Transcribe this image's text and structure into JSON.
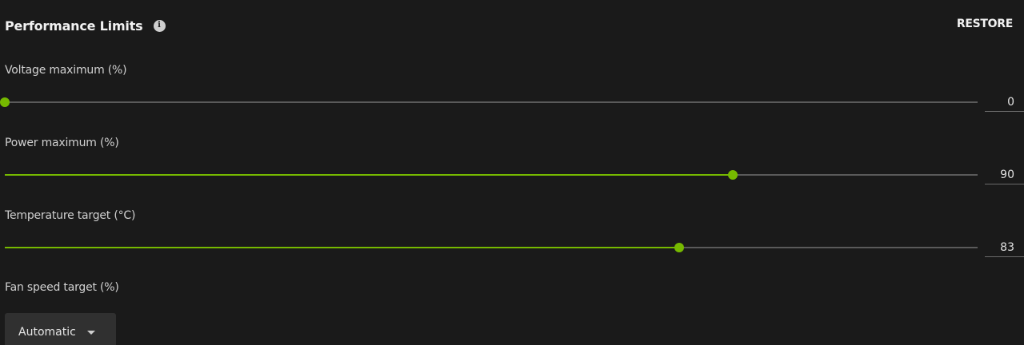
{
  "header": {
    "title": "Performance Limits",
    "info_icon": "info-icon",
    "restore_label": "RESTORE"
  },
  "sliders": [
    {
      "label": "Voltage maximum (%)",
      "value": "0",
      "fraction": 0.0
    },
    {
      "label": "Power maximum (%)",
      "value": "90",
      "fraction": 0.748
    },
    {
      "label": "Temperature target (°C)",
      "value": "83",
      "fraction": 0.693
    }
  ],
  "fan": {
    "label": "Fan speed target (%)",
    "selected": "Automatic"
  },
  "colors": {
    "accent": "#76b900",
    "background": "#1a1a1a"
  }
}
